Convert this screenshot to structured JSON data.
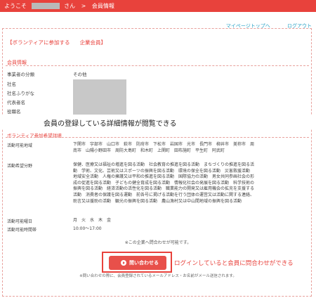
{
  "header": {
    "welcome": "ようこそ",
    "san": "さん",
    "arrow": ">",
    "page": "会員情報"
  },
  "nav": {
    "mypage_top": "マイページトップへ",
    "logout": "ログアウト"
  },
  "section": {
    "volunteer_label": "【ボランティアに参加する",
    "member_type": "企業会員】"
  },
  "member_info": {
    "title": "会員情報",
    "rows": [
      {
        "label": "事業者の分類",
        "value": "その他"
      },
      {
        "label": "社名",
        "value": ""
      },
      {
        "label": "社名ふりがな",
        "value": ""
      },
      {
        "label": "代表者名",
        "value": ""
      },
      {
        "label": "役職名",
        "value": ""
      }
    ]
  },
  "callout_detail": "会員の登録している詳細情報が閲覧できる",
  "volunteer_hope": {
    "title": "ボランティア参加希望詳細",
    "area_label": "活動可能地域",
    "area_value": "下関市　宇部市　山口市　萩市　防府市　下松市　岩国市　光市　長門市　柳井市　美祢市　周南市　山陽小野田市　周防大島町　和木町　上関町　田布施町　平生町　阿武町",
    "field_label": "活動希望分野",
    "field_value": "保健、医療又は福祉の増進を図る活動　社会教育の推進を図る活動　まちづくりの推進を図る活動　学術、文化、芸術又はスポーツの振興を図る活動　環境の保全を図る活動　災害救援活動　地域安全活動　人権の擁護又は平和の推進を図る活動　国際協力の活動　男女共同参画社会の形成の促進を図る活動　子どもの健全育成を図る活動　情報化社会の発展を図る活動　科学技術の振興を図る活動　経済活動の活性化を図る活動　職業能力の開発又は雇用機会の拡充を支援する活動　消費者の保護を図る運動　前各号に掲げる活動を行う団体の運営又は活動に関する連絡、助言又は援助の活動　観光の振興を図る活動　農山漁村又は中山間地域の振興を図る活動",
    "day_label": "活動可能曜日",
    "day_value": "月　火　水　木　金",
    "time_label": "活動可能時間帯",
    "time_value": "10:00～17:00"
  },
  "notice": "※この企業へ問合わせが可能です。",
  "contact_button": "問い合わせる",
  "callout_login": "ログインしていると会員に問合わせができる",
  "contact_note": "※問い合わせの際に、会員登録されているメールアドレス・お名前がメール送信されます。",
  "colors": {
    "accent": "#e8423c",
    "link": "#2aa3c7",
    "mask": "#c8c8c8"
  }
}
